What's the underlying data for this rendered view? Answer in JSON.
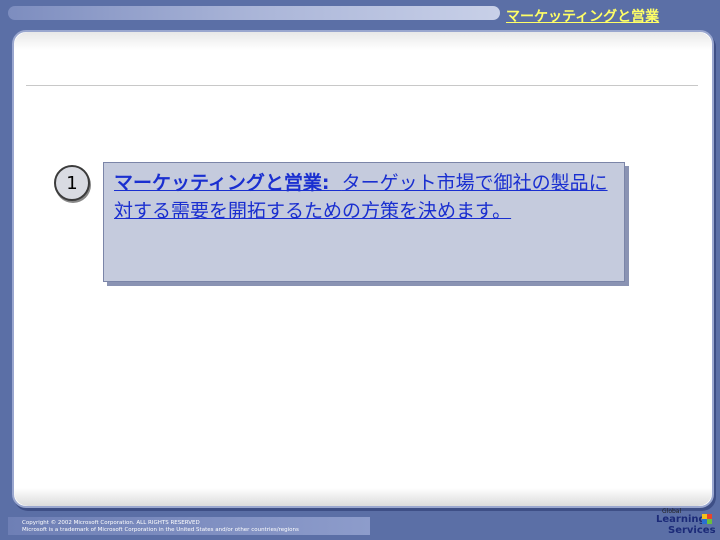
{
  "header": {
    "title": "マーケッティングと営業"
  },
  "item": {
    "number": "1",
    "title": "マーケッティングと営業:",
    "body": "ターゲット市場で御社の製品に対する需要を開拓するための方策を決めます。"
  },
  "footer": {
    "copyright": "Copyright © 2002 Microsoft Corporation. ALL RIGHTS RESERVED",
    "trademark": "Microsoft is a trademark of Microsoft Corporation in the United States and/or other countries/regions"
  },
  "logo": {
    "line1": "Global",
    "line2": "Learning",
    "line3": "Services"
  },
  "colors": {
    "background": "#5b6fa6",
    "accent_text": "#1a2fd0",
    "header_text": "#ffff66"
  }
}
